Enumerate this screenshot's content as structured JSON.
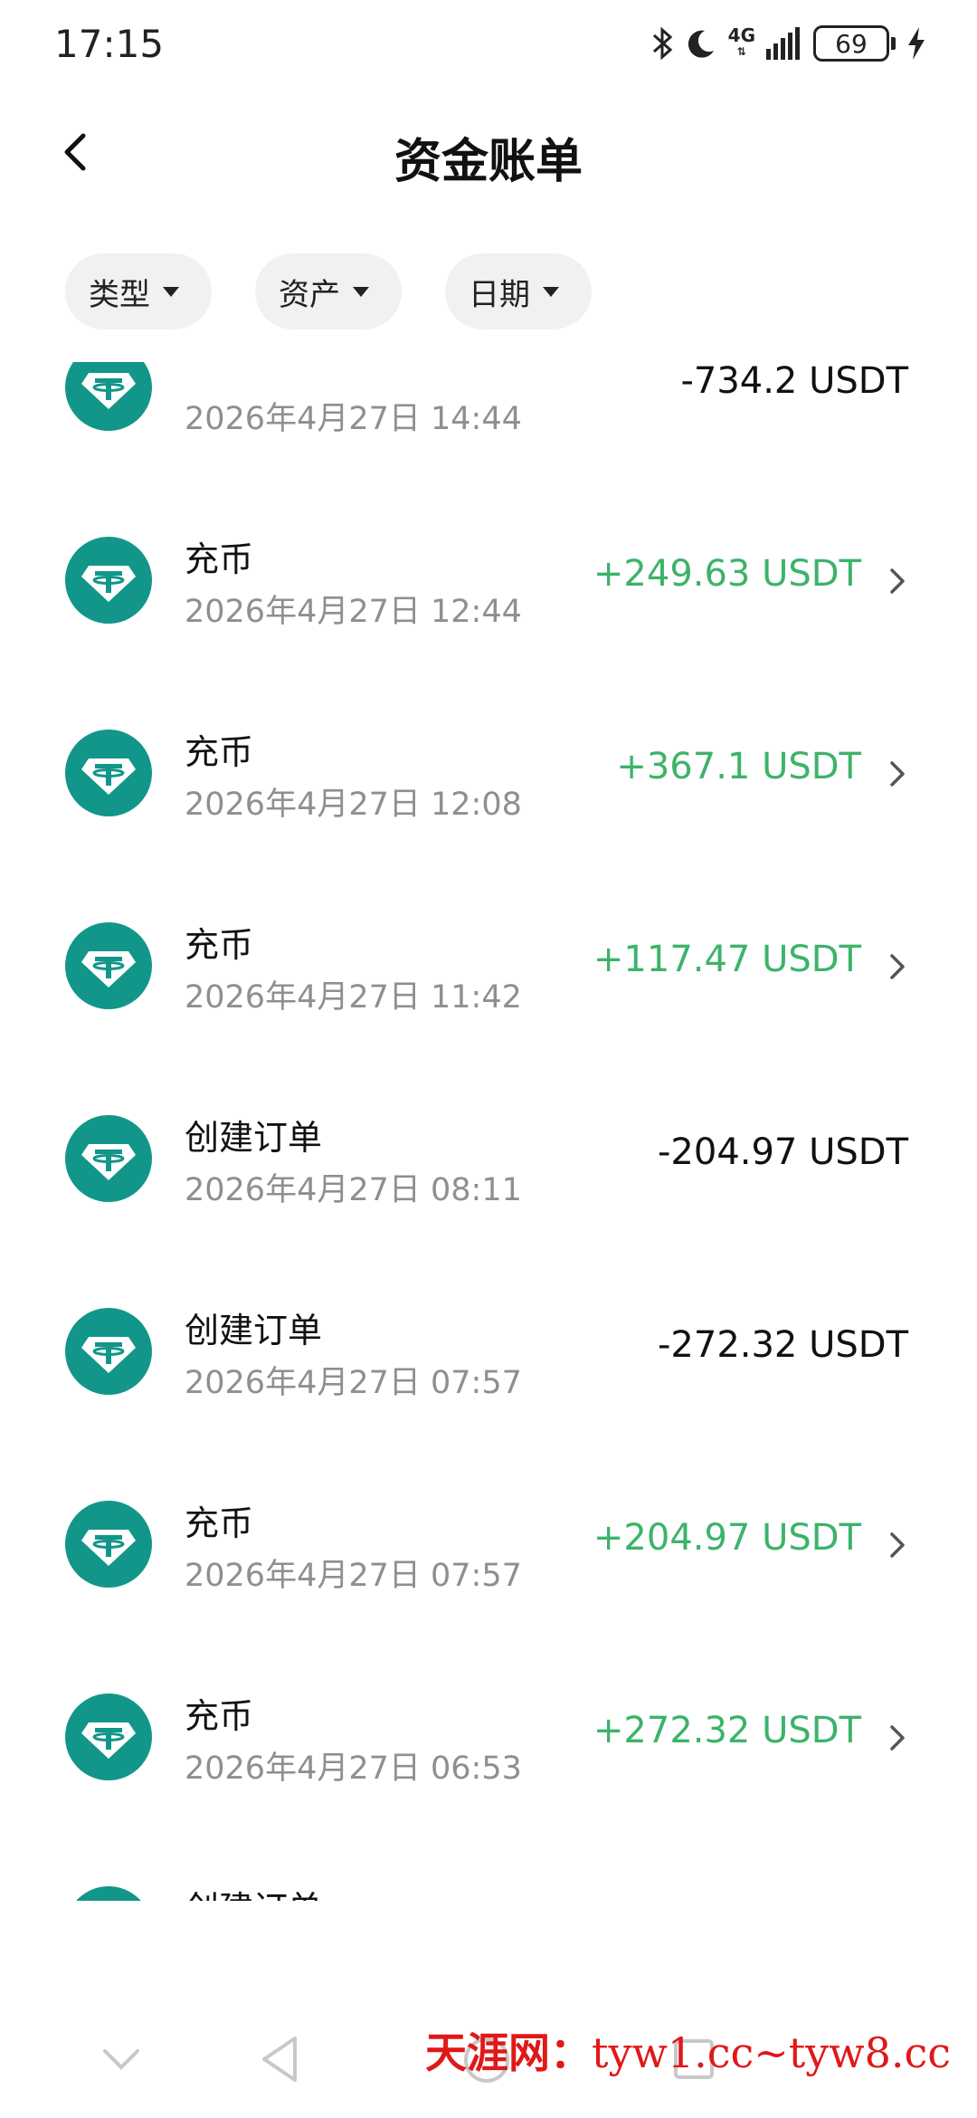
{
  "status_bar": {
    "time": "17:15",
    "network": "4G",
    "battery": "69"
  },
  "header": {
    "title": "资金账单"
  },
  "filters": [
    {
      "label": "类型"
    },
    {
      "label": "资产"
    },
    {
      "label": "日期"
    }
  ],
  "transactions": [
    {
      "type": "",
      "date": "2026年4月27日 14:44",
      "amount": "-734.2 USDT",
      "direction": "out"
    },
    {
      "type": "充币",
      "date": "2026年4月27日 12:44",
      "amount": "+249.63 USDT",
      "direction": "in"
    },
    {
      "type": "充币",
      "date": "2026年4月27日 12:08",
      "amount": "+367.1 USDT",
      "direction": "in"
    },
    {
      "type": "充币",
      "date": "2026年4月27日 11:42",
      "amount": "+117.47 USDT",
      "direction": "in"
    },
    {
      "type": "创建订单",
      "date": "2026年4月27日 08:11",
      "amount": "-204.97 USDT",
      "direction": "out"
    },
    {
      "type": "创建订单",
      "date": "2026年4月27日 07:57",
      "amount": "-272.32 USDT",
      "direction": "out"
    },
    {
      "type": "充币",
      "date": "2026年4月27日 07:57",
      "amount": "+204.97 USDT",
      "direction": "in"
    },
    {
      "type": "充币",
      "date": "2026年4月27日 06:53",
      "amount": "+272.32 USDT",
      "direction": "in"
    },
    {
      "type": "创建订单",
      "date": "",
      "amount": "",
      "direction": "out"
    }
  ],
  "watermark": {
    "cn": "天涯网：",
    "url": "tyw1.cc~tyw8.cc"
  },
  "colors": {
    "positive": "#3cb36a",
    "icon_teal": "#12968a",
    "watermark": "#e01818"
  },
  "icons": {
    "back": "chevron-left-icon",
    "coin": "usdt-tether-icon",
    "row_chevron": "chevron-right-icon"
  }
}
